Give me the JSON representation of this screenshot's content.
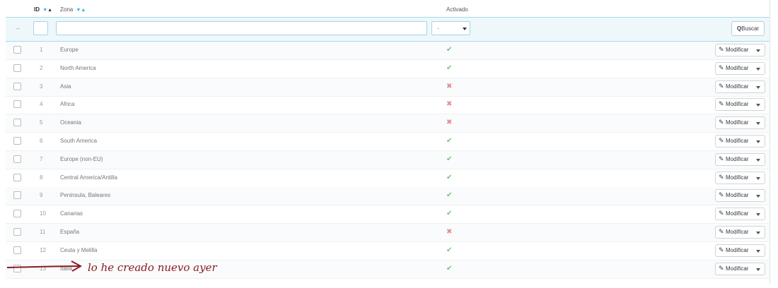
{
  "table": {
    "headers": {
      "id": "ID",
      "zona": "Zona",
      "activado": "Activado"
    },
    "filter": {
      "dash": "–",
      "activado_value": "-",
      "search_label": "Buscar"
    },
    "rows": [
      {
        "id": "1",
        "zona": "Europe",
        "active": true
      },
      {
        "id": "2",
        "zona": "North America",
        "active": true
      },
      {
        "id": "3",
        "zona": "Asia",
        "active": false
      },
      {
        "id": "4",
        "zona": "Africa",
        "active": false
      },
      {
        "id": "5",
        "zona": "Oceania",
        "active": false
      },
      {
        "id": "6",
        "zona": "South America",
        "active": true
      },
      {
        "id": "7",
        "zona": "Europe (non-EU)",
        "active": true
      },
      {
        "id": "8",
        "zona": "Central America/Antilla",
        "active": true
      },
      {
        "id": "9",
        "zona": "Peninsula, Baleares",
        "active": true
      },
      {
        "id": "10",
        "zona": "Canarias",
        "active": true
      },
      {
        "id": "11",
        "zona": "España",
        "active": false
      },
      {
        "id": "12",
        "zona": "Ceuta y Melilla",
        "active": true
      },
      {
        "id": "13",
        "zona": "Italia",
        "active": true
      }
    ],
    "row_action_label": "Modificar"
  },
  "icons": {
    "check": "✔",
    "cross": "✖",
    "pencil": "✎",
    "search": "🔍"
  },
  "annotation": {
    "text": "lo he creado nuevo ayer",
    "color": "#8b1a22"
  },
  "colors": {
    "accent": "#25b9d7",
    "active": "#72c279",
    "inactive": "#e08f95"
  }
}
